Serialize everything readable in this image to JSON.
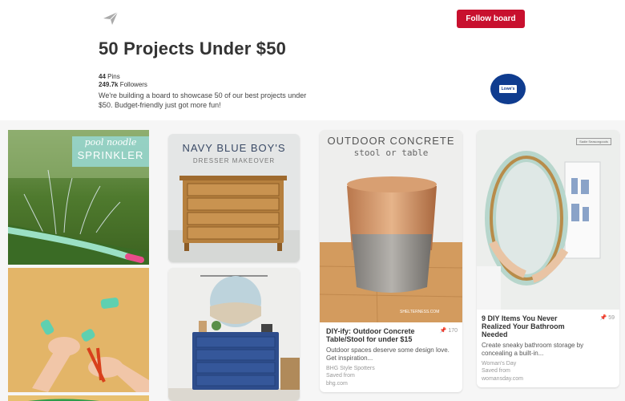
{
  "header": {
    "follow_label": "Follow board",
    "title": "50 Projects Under $50",
    "pins_count": "44",
    "pins_label": "Pins",
    "followers_count": "249.7k",
    "followers_label": "Followers",
    "description": "We're building a board to showcase 50 of our best projects under $50. Budget-friendly just got more fun!",
    "avatar_logo": "Lowe's",
    "brand_color": "#c8102e"
  },
  "pins": {
    "sprinkler": {
      "overlay_line1": "pool noodle",
      "overlay_line2": "SPRINKLER"
    },
    "dresser": {
      "overlay_line1": "NAVY BLUE BOY'S",
      "overlay_line2": "DRESSER MAKEOVER"
    },
    "concrete": {
      "overlay_line1": "OUTDOOR CONCRETE",
      "overlay_line2": "stool or table",
      "watermark": "SHELTERNESS.COM",
      "repin_count": "170",
      "title": "DIY-ify: Outdoor Concrete Table/Stool for under $15",
      "description": "Outdoor spaces deserve some design love. Get inspiration...",
      "source": "BHG Style Spotters",
      "saved_label": "Saved from",
      "saved_site": "bhg.com"
    },
    "mirror": {
      "badge": "Sadie Seasongoods",
      "repin_count": "59",
      "title": "9 DIY Items You Never Realized Your Bathroom Needed",
      "description": "Create sneaky bathroom storage by concealing a built-in...",
      "source": "Woman's Day",
      "saved_label": "Saved from",
      "saved_site": "womansday.com"
    }
  }
}
